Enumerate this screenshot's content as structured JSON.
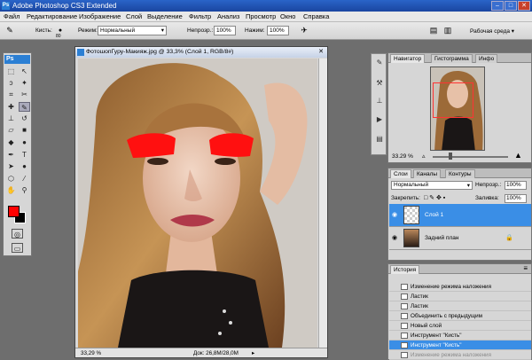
{
  "app": {
    "title": "Adobe Photoshop CS3 Extended",
    "ps_logo": "Ps",
    "win_min": "–",
    "win_max": "□",
    "win_close": "✕"
  },
  "menu": [
    "Файл",
    "Редактирование",
    "Изображение",
    "Слой",
    "Выделение",
    "Фильтр",
    "Анализ",
    "Просмотр",
    "Окно",
    "Справка"
  ],
  "options": {
    "brush_label": "Кисть:",
    "brush_size": "80",
    "mode_label": "Режим:",
    "mode_value": "Нормальный",
    "opacity_label": "Непрозр.:",
    "opacity_value": "100%",
    "flow_label": "Нажим:",
    "flow_value": "100%",
    "workspace_label": "Рабочая среда ▾"
  },
  "tools": {
    "header": "Ps",
    "foreground_color": "#ff0000",
    "background_color": "#000000"
  },
  "document": {
    "title": "ФотошопГуру-Макияж.jpg @ 33,3% (Слой 1, RGB/8#)",
    "close": "✕",
    "zoom": "33,29 %",
    "doc_size": "Док: 26,8M/28,0M"
  },
  "navigator": {
    "tabs": [
      "Навигатор",
      "Гистограмма",
      "Инфо"
    ],
    "zoom": "33.29 %"
  },
  "layers": {
    "tabs": [
      "Слои",
      "Каналы",
      "Контуры"
    ],
    "blend_mode": "Нормальный",
    "opacity_label": "Непрозр.:",
    "opacity_value": "100%",
    "lock_label": "Закрепить:",
    "fill_label": "Заливка:",
    "fill_value": "100%",
    "items": [
      {
        "name": "Слой 1",
        "selected": true
      },
      {
        "name": "Задний план",
        "selected": false
      }
    ],
    "lock_glyph": "🔒"
  },
  "history": {
    "tab": "История",
    "items": [
      {
        "label": "Изменение режима наложения",
        "state": "normal"
      },
      {
        "label": "Ластик",
        "state": "normal"
      },
      {
        "label": "Ластик",
        "state": "normal"
      },
      {
        "label": "Объединить с предыдущим",
        "state": "normal"
      },
      {
        "label": "Новый слой",
        "state": "normal"
      },
      {
        "label": "Инструмент \"Кисть\"",
        "state": "normal"
      },
      {
        "label": "Инструмент \"Кисть\"",
        "state": "selected"
      },
      {
        "label": "Изменение режима наложения",
        "state": "dim"
      }
    ]
  },
  "colors": {
    "titlebar": "#1a45a0",
    "selection": "#3a8ee6",
    "brush_red": "#ff1010"
  }
}
